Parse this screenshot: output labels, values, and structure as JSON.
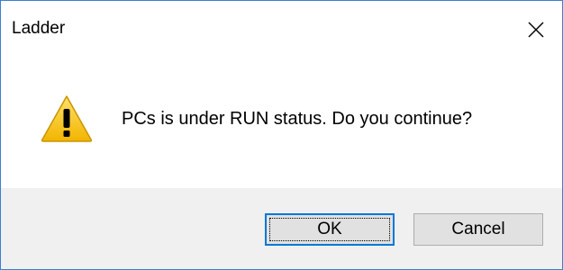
{
  "window": {
    "title": "Ladder",
    "close_icon": "close-icon"
  },
  "dialog": {
    "icon": "warning-icon",
    "message": "PCs is under RUN status. Do you continue?"
  },
  "buttons": {
    "ok_label": "OK",
    "cancel_label": "Cancel"
  },
  "colors": {
    "border": "#3c7fd0",
    "footer_bg": "#f0f0f0",
    "focus_border": "#0078d7",
    "warning_yellow": "#f7c31a"
  }
}
